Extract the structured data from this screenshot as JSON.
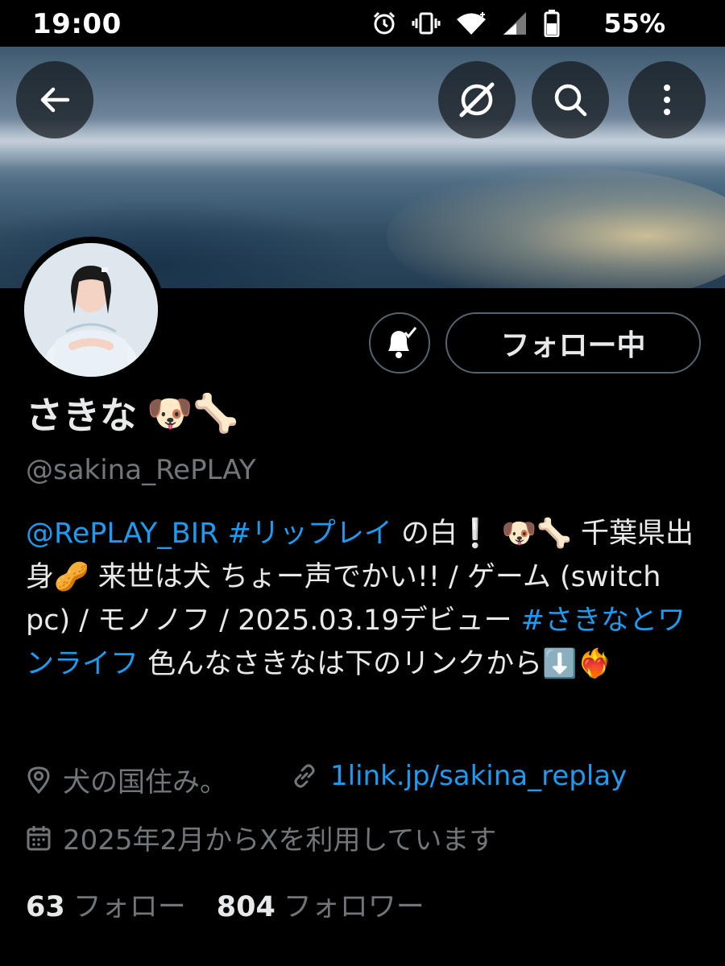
{
  "status_bar": {
    "time": "19:00",
    "battery": "55%",
    "icons": [
      "alarm-icon",
      "vibrate-icon",
      "wifi-icon",
      "signal-icon",
      "battery-icon"
    ]
  },
  "header": {
    "buttons": [
      "back-arrow-icon",
      "grok-icon",
      "search-icon",
      "more-vertical-icon"
    ]
  },
  "profile": {
    "display_name": "さきな",
    "name_emoji": "🐶🦴",
    "handle": "@sakina_RePLAY",
    "follow_button": "フォロー中",
    "bio": {
      "mention": "@RePLAY_BIR",
      "hashtag1": "#リップレイ",
      "text1": " の白❕ 🐶🦴 千葉県出身🥜 来世は犬 ちょー声でかい!! / ゲーム (switch pc) / モノノフ / 2025.03.19デビュー ",
      "hashtag2": "#さきなとワンライフ",
      "text2": " 色んなさきなは下のリンクから⬇️❤️‍🔥"
    },
    "location": "犬の国住み。",
    "url": "1link.jp/sakina_replay",
    "joined": "2025年2月からXを利用しています",
    "following_count": "63",
    "following_label": "フォロー",
    "followers_count": "804",
    "followers_label": "フォロワー"
  },
  "colors": {
    "background": "#000000",
    "text": "#e7e9ea",
    "secondary": "#71767b",
    "link": "#1d9bf0",
    "border": "#536471"
  }
}
